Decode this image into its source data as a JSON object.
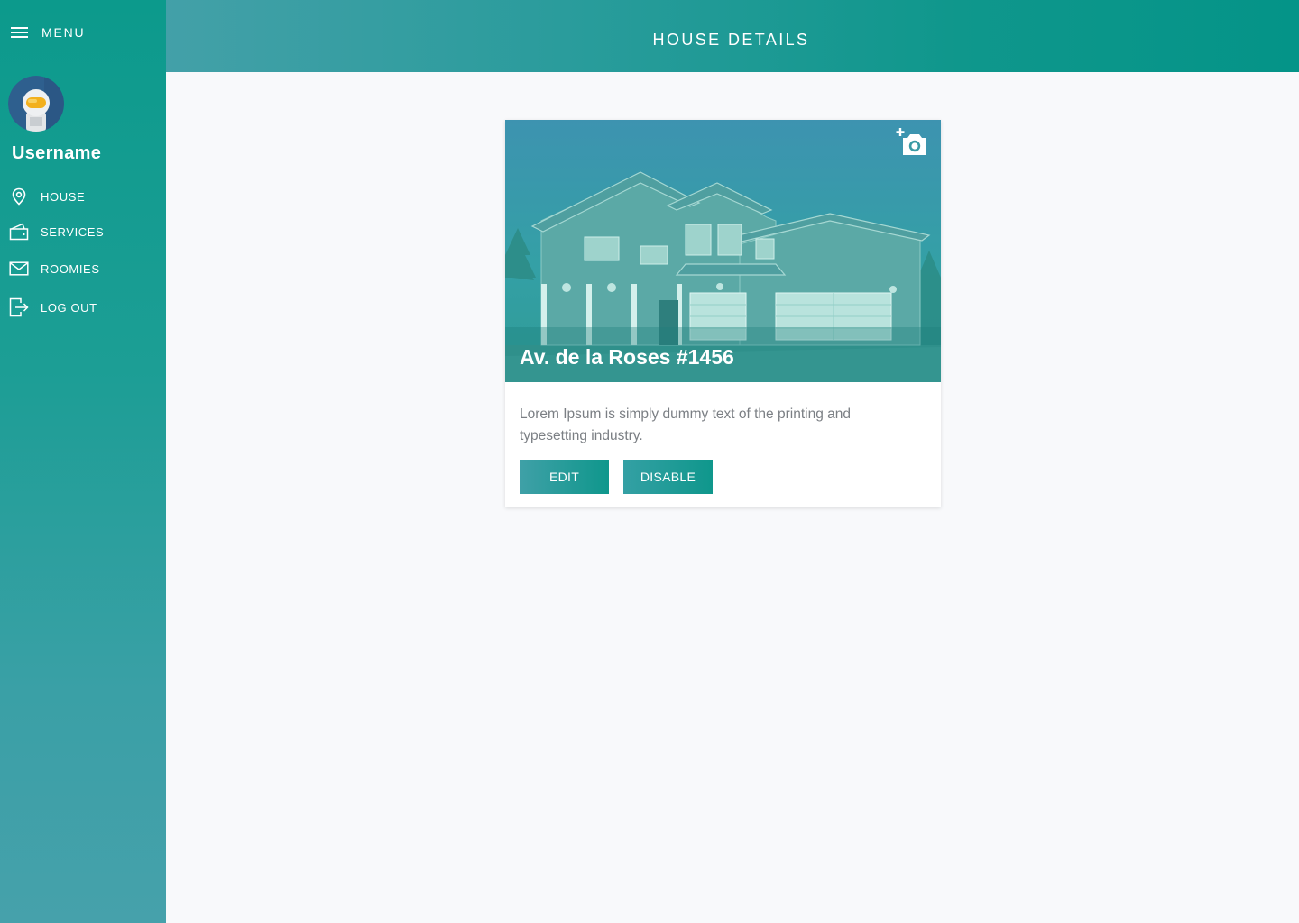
{
  "sidebar": {
    "menu_label": "MENU",
    "username": "Username",
    "items": [
      {
        "label": "HOUSE",
        "icon": "location-pin-icon"
      },
      {
        "label": "SERVICES",
        "icon": "wallet-icon"
      },
      {
        "label": "ROOMIES",
        "icon": "envelope-icon"
      },
      {
        "label": "LOG OUT",
        "icon": "logout-icon"
      }
    ]
  },
  "header": {
    "title": "HOUSE DETAILS"
  },
  "card": {
    "title": "Av. de la Roses #1456",
    "description": "Lorem Ipsum is simply dummy text of the printing and typesetting industry.",
    "edit_label": "EDIT",
    "disable_label": "DISABLE",
    "media_icon": "add-photo-icon"
  },
  "colors": {
    "accent": "#0f978c",
    "accent_light": "#43a0a8"
  }
}
